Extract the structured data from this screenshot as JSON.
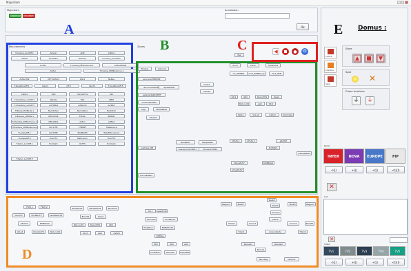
{
  "window": {
    "title": "Majordom"
  },
  "header": {
    "left_label": "Majordom",
    "annotation_label": "Annotation",
    "ok_button": "Ok",
    "green_button": "CONNEXION",
    "red_button": "DECONNEXION"
  },
  "zones": {
    "mouvements_label": "Mouvements",
    "zones_label": "Zones",
    "letter_a": "A",
    "letter_b": "B",
    "letter_c": "C",
    "letter_d": "D",
    "letter_e": "E"
  },
  "colors": {
    "blue": "#1f3fe0",
    "green": "#1f8f2a",
    "red": "#e02020",
    "orange": "#f08a24",
    "accent": "#1f3fe0"
  },
  "panelA": [
    "T.Cuisine_LumOff.1",
    "Arosoir",
    "AOZ",
    "Cafard",
    "VOilet",
    "Humbam",
    "DeCoos",
    "T.Cuisine_LumOff.5",
    "Anfiec",
    "T.Cuisine_DESColonne.1",
    "AnfiecNOilet",
    "Anfiec",
    "T.Cuisine_MONColonne.1",
    "Anfiec342",
    "OK*1Cafard",
    "Ahn2",
    "Nuitee",
    "T.SousBrosOff.1",
    "Deam",
    "mTZ",
    "Ilee74",
    "T.SousBrosOff.5",
    "Cafard",
    "OK/I",
    "HordeHT10",
    "Eek",
    "T.Chambre_LumOff.1",
    "Wedde",
    "Ealt",
    "OB/8",
    "T.Chambre_LumOff.5",
    "ArtFOBet",
    "ArtNum2",
    "ArtDK2",
    "T.NiteauxSUMLite.1",
    "Nechtehen",
    "NecCaRosc",
    "NecDK22",
    "T.Niteaux_DEVMe.1",
    "RIPlosTDZ",
    "EXCab",
    "RIPEtst",
    "T.Chambre_DESColonne.1",
    "NPlosDDA",
    "AkFun",
    "ARFeit",
    "T.Chambre_MONColonne.1",
    "Dor1THE",
    "THEKNT",
    "TIlleService",
    "T.LampeOff.1",
    "Dor2THE",
    "TeleMfoN3",
    "TwedMfocument",
    "T.LampeOff.3",
    "HumTTS",
    "MethnLum",
    "HumTT0",
    "T.Salon_LumOff.1",
    "Humbam",
    "OnTTS",
    "Humbam",
    "T.Salon_LumOff.3"
  ],
  "panelB": [
    "Bosque",
    "Raincoll",
    "esconnectSERVE2",
    "renconnectSAIME",
    "apresGSAR",
    "esdeclectARCCNTE",
    "rendectDASPEA",
    "Celsu1",
    "CelsAt2",
    "Ofgo",
    "ONTAIBDIN",
    "DLIsitot",
    "Eek",
    "Ann3",
    "Hen2",
    "Humbam1",
    "mc_SIEMMA",
    "mic2_SIEMM_mp",
    "mic2_HEM",
    "OK.2",
    "OK/I",
    "DeconTKS",
    "Deam",
    "DAC.conf1",
    "sel1",
    "OK.2",
    "ItelA1",
    "VoL.a2",
    "Cafard",
    "CommeCa",
    "enetrees_tlM",
    "MeapBCIC",
    "MeapBONC",
    "Descendre1TORE1",
    "MonterSTORE1",
    "hFILM_1",
    "hFILM_2",
    "pdrMAT",
    "PLUSBint",
    "mettreMERO",
    "MoinsEnTV",
    "MOBIDIsit",
    "ChlneEnTV",
    "annuelleNOS"
  ],
  "panelC": {
    "buttons": [
      "rewind-icon",
      "stop-icon",
      "record-icon",
      "power-icon"
    ]
  },
  "panelD": [
    "FILM_1",
    "FILM_2",
    "CerolTO",
    "PLUSBinTS",
    "CerolBeCaTO",
    "CEnkTS",
    "MOBIDsTC",
    "VoLa2",
    "ChandreTV",
    "DAC.conf1",
    "RecMeTG2",
    "RecCaMTG2",
    "RecVolu4",
    "Bim702",
    "VoLa2",
    "DAC.conf1",
    "DeconTKS",
    "OK/I",
    "Ahn3",
    "sel2",
    "Cafard",
    "OK.1",
    "esetrPoIO",
    "TICunsCa",
    "PLUSBinTS",
    "FiCalRer2",
    "MOBIDbnTS",
    "YaEMee",
    "OK1",
    "OK/I",
    "sel2",
    "ChdIOBen",
    "DAC.Men",
    "VoltsOMen",
    "Reguer1",
    "TeleD2",
    "TeleD3",
    "TeleD5",
    "Reguer2",
    "OkOkle",
    "Fen7olo",
    "Phote1",
    "Annev1",
    "Justice",
    "Annev2",
    "Photet2",
    "Tdeci1",
    "Acascollente",
    "Tdeci2",
    "Reculei1",
    "Reculei2",
    "Neculei",
    "Neculsee",
    "Outdoor"
  ],
  "panelE": {
    "title": "Domus :",
    "store_label": "Store",
    "spot_label": "Spot",
    "prises_label": "Prises locations",
    "radio_label": "Radio",
    "list_label": "List",
    "video_label": "Video",
    "tabs": [
      "Cuisine",
      "Chambre",
      "Salon"
    ],
    "radio_names": [
      "INTER",
      "NOVA",
      "EUROPE",
      "FIP"
    ],
    "video_names": [
      "TV1",
      "TV2",
      "TV3",
      "TV4",
      "TV5"
    ],
    "volume_values": [
      "<(|)",
      "+(|)",
      "<(|)",
      "<(|)))"
    ]
  }
}
